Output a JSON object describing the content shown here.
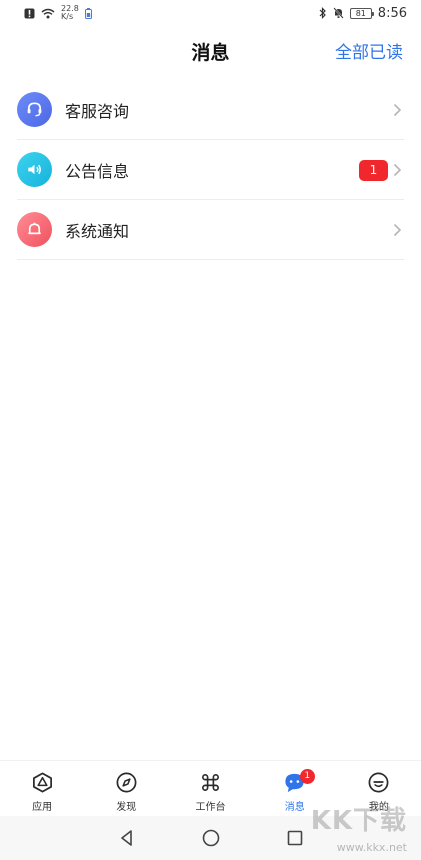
{
  "status_bar": {
    "net_speed_value": "22.8",
    "net_speed_unit": "K/s",
    "battery": "81",
    "time": "8:56"
  },
  "header": {
    "title": "消息",
    "mark_all_read": "全部已读"
  },
  "messages": [
    {
      "label": "客服咨询",
      "icon": "headset-icon",
      "color": "#5b79ef",
      "badge": ""
    },
    {
      "label": "公告信息",
      "icon": "speaker-icon",
      "color": "#1fbfe3",
      "badge": "1"
    },
    {
      "label": "系统通知",
      "icon": "bell-icon",
      "color": "#f4606c",
      "badge": ""
    }
  ],
  "tab_bar": {
    "active_color": "#2f74e8",
    "tabs": [
      {
        "label": "应用",
        "icon": "apps-triangle-icon"
      },
      {
        "label": "发现",
        "icon": "compass-icon"
      },
      {
        "label": "工作台",
        "icon": "command-icon"
      },
      {
        "label": "消息",
        "icon": "chat-bubble-icon",
        "badge": "1",
        "active": true
      },
      {
        "label": "我的",
        "icon": "smiley-icon"
      }
    ]
  },
  "watermark": {
    "logo_text": "KK下载",
    "url": "www.kkx.net"
  }
}
